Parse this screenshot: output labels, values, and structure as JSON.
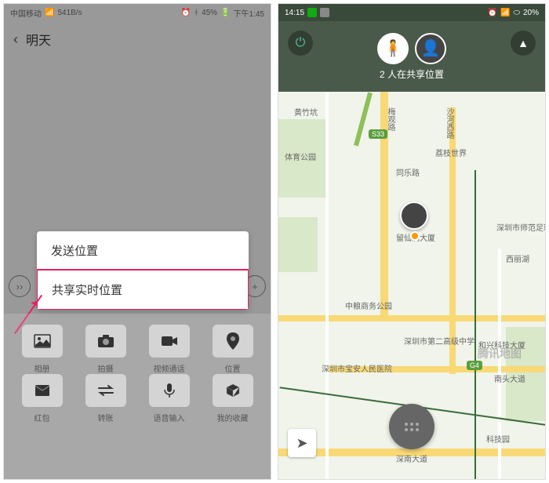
{
  "left": {
    "status": {
      "carrier": "中国移动",
      "net": "541B/s",
      "battery": "45%",
      "time": "下午1:45"
    },
    "header": {
      "title": "明天"
    },
    "popup": {
      "items": [
        "发送位置",
        "共享实时位置"
      ],
      "highlight_index": 1
    },
    "tools": [
      {
        "icon": "🖼",
        "label": "相册"
      },
      {
        "icon": "📷",
        "label": "拍摄"
      },
      {
        "icon": "📹",
        "label": "视频通话"
      },
      {
        "icon": "📍",
        "label": "位置"
      },
      {
        "icon": "✉",
        "label": "红包"
      },
      {
        "icon": "⇄",
        "label": "转账"
      },
      {
        "icon": "🎤",
        "label": "语音输入"
      },
      {
        "icon": "📦",
        "label": "我的收藏"
      }
    ]
  },
  "right": {
    "status": {
      "time": "14:15",
      "battery": "20%"
    },
    "sharing_text": "2 人在共享位置",
    "map_labels": {
      "huangzhukeng": "黄竹坑",
      "sport_park": "体育公园",
      "tongle": "同乐路",
      "lizhi": "荔枝世界",
      "shahe": "沙河西路",
      "liuxiandong": "留仙洞大厦",
      "shenzhen_normal": "深圳市师范足球训练场",
      "xili": "西丽湖",
      "zhongliang": "中粮商务公园",
      "shenzhen2": "深圳市第二高级中学",
      "hexing": "和兴科技大厦",
      "baoan": "深圳市宝安人民医院",
      "nantou": "南头大道",
      "kejiyuan": "科技园",
      "shennan": "深南大道",
      "meiguan": "梅观路",
      "s33": "S33",
      "g4": "G4",
      "watermark": "腾讯地图"
    }
  }
}
